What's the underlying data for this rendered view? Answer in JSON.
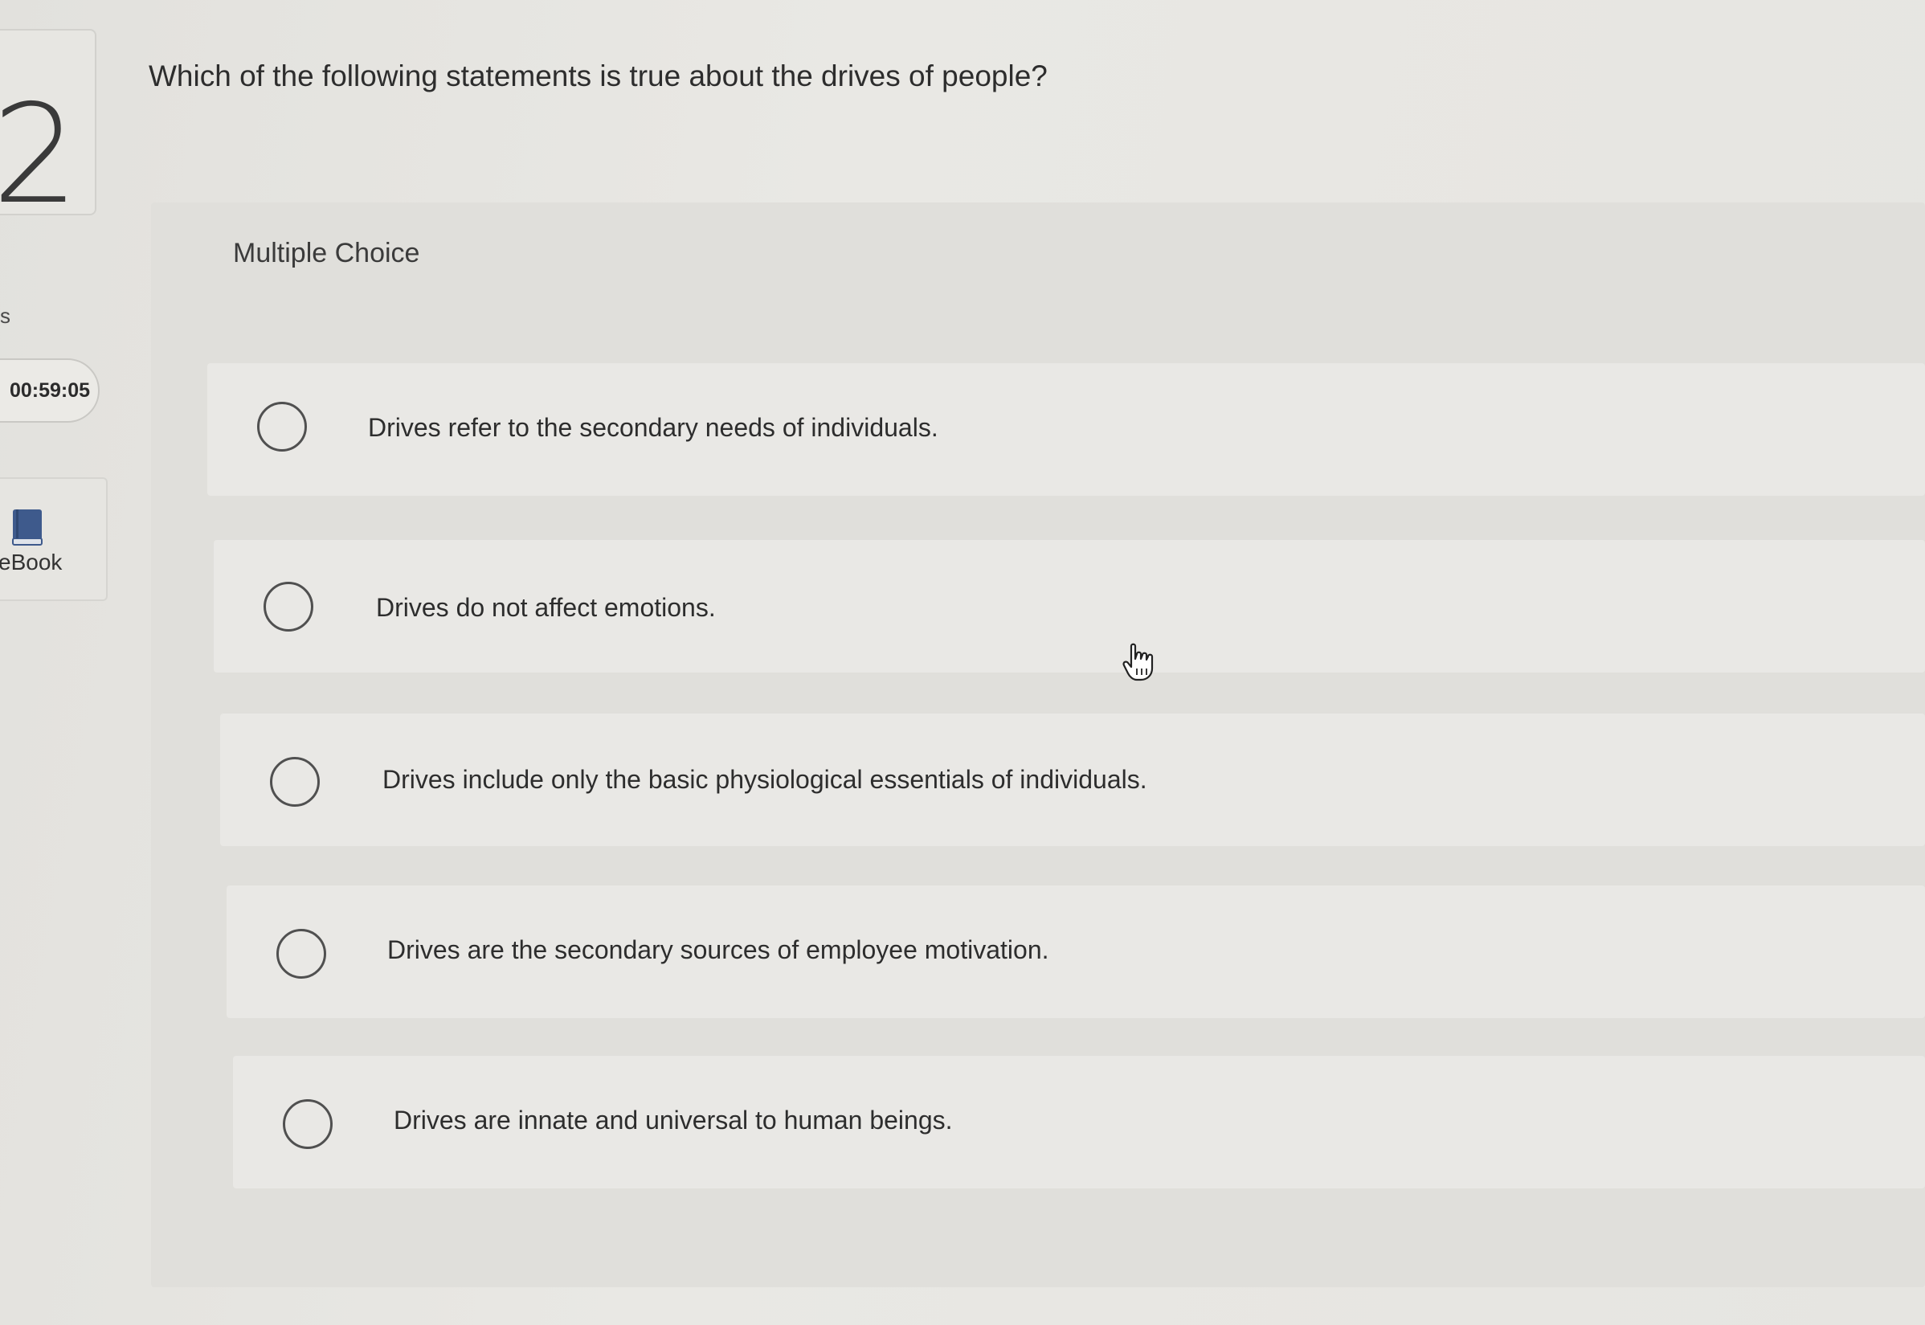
{
  "question": {
    "number": "2",
    "text": "Which of the following statements is true about the drives of people?"
  },
  "sidebar": {
    "points_label": "s",
    "timer": "00:59:05",
    "ebook_label": "eBook"
  },
  "answer_area": {
    "type_label": "Multiple Choice",
    "options": [
      {
        "label": "Drives refer to the secondary needs of individuals.",
        "selected": false
      },
      {
        "label": "Drives do not affect emotions.",
        "selected": false
      },
      {
        "label": "Drives include only the basic physiological essentials of individuals.",
        "selected": false
      },
      {
        "label": "Drives are the secondary sources of employee motivation.",
        "selected": false
      },
      {
        "label": "Drives are innate and universal to human beings.",
        "selected": false
      }
    ]
  },
  "colors": {
    "background": "#e6e5e1",
    "panel": "#e0dfdb",
    "option_row": "#e9e8e5",
    "ebook_icon": "#3e5a8c"
  },
  "icons": {
    "ebook": "book-icon",
    "cursor": "hand-pointer-icon"
  }
}
